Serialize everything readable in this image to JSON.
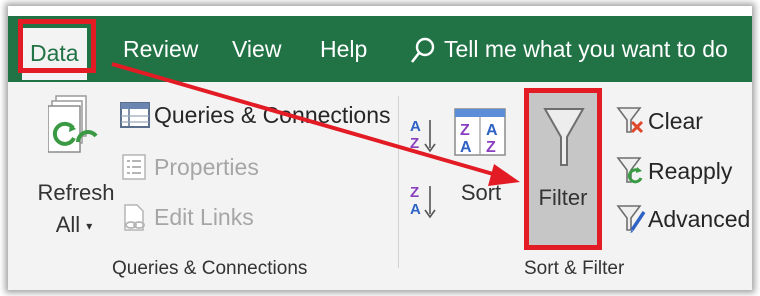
{
  "tabs": {
    "data": "Data",
    "review": "Review",
    "view": "View",
    "help": "Help"
  },
  "tell_me": "Tell me what you want to do",
  "queries_group": {
    "refresh_line1": "Refresh",
    "refresh_line2": "All",
    "queries_connections": "Queries & Connections",
    "properties": "Properties",
    "edit_links": "Edit Links",
    "group_label": "Queries & Connections"
  },
  "sort_group": {
    "sort": "Sort",
    "filter": "Filter",
    "clear": "Clear",
    "reapply": "Reapply",
    "advanced": "Advanced",
    "group_label": "Sort & Filter"
  },
  "colors": {
    "ribbon_green": "#217346",
    "highlight_red": "#e21b24"
  }
}
